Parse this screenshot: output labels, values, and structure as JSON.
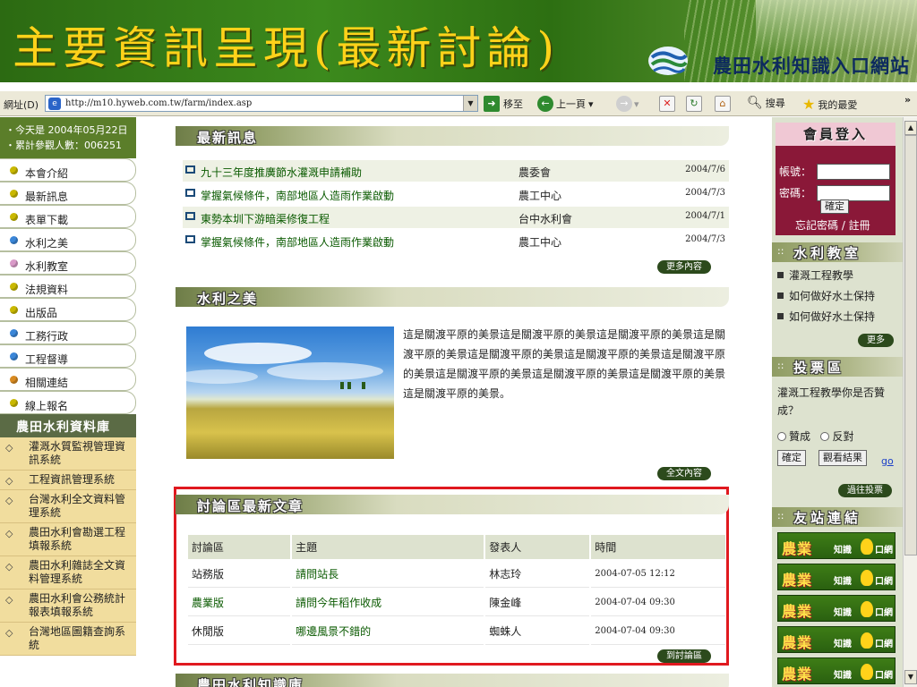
{
  "slide": {
    "title": "主要資訊呈現(最新討論)",
    "logo_text": "農田水利知識入口網站"
  },
  "browser": {
    "address_label": "網址(D)",
    "url": "http://m10.hyweb.com.tw/farm/index.asp",
    "go_label": "移至",
    "back_label": "上一頁",
    "search_label": "搜尋",
    "favorites_label": "我的最愛",
    "more_label": "»"
  },
  "left": {
    "date_line": "・今天是 2004年05月22日",
    "visitors_line": "・累計參觀人數：006251",
    "nav": [
      {
        "label": "本會介紹",
        "dot": "#c9b800"
      },
      {
        "label": "最新訊息",
        "dot": "#c9b800"
      },
      {
        "label": "表單下載",
        "dot": "#c9b800"
      },
      {
        "label": "水利之美",
        "dot": "#3a86d8"
      },
      {
        "label": "水利教室",
        "dot": "#d99ac8"
      },
      {
        "label": "法規資料",
        "dot": "#c9b800"
      },
      {
        "label": "出版品",
        "dot": "#c9b800"
      },
      {
        "label": "工務行政",
        "dot": "#3a86d8"
      },
      {
        "label": "工程督導",
        "dot": "#3a86d8"
      },
      {
        "label": "相關連結",
        "dot": "#d88a20"
      },
      {
        "label": "線上報名",
        "dot": "#c9b800"
      }
    ],
    "database_title": "農田水利資料庫",
    "database_items": [
      "灌溉水質監視管理資訊系統",
      "工程資訊管理系統",
      "台灣水利全文資料管理系統",
      "農田水利會勘選工程填報系統",
      "農田水利雜誌全文資料管理系統",
      "農田水利會公務統計報表填報系統",
      "台灣地區圖籍查詢系統"
    ]
  },
  "news": {
    "title": "最新訊息",
    "items": [
      {
        "title": "九十三年度推廣節水灌溉申請補助",
        "unit": "農委會",
        "date": "2004/7/6"
      },
      {
        "title": "掌握氣候條件，南部地區人造雨作業啟動",
        "unit": "農工中心",
        "date": "2004/7/3"
      },
      {
        "title": "東勢本圳下游暗渠修復工程",
        "unit": "台中水利會",
        "date": "2004/7/1"
      },
      {
        "title": "掌握氣候條件，南部地區人造雨作業啟動",
        "unit": "農工中心",
        "date": "2004/7/3"
      }
    ],
    "more_label": "更多內容"
  },
  "beauty": {
    "title": "水利之美",
    "text": "這是關渡平原的美景這是關渡平原的美景這是關渡平原的美景這是關渡平原的美景這是關渡平原的美景這是關渡平原的美景這是關渡平原的美景這是關渡平原的美景這是關渡平原的美景這是關渡平原的美景這是關渡平原的美景。",
    "more_label": "全文內容"
  },
  "discussion": {
    "title": "討論區最新文章",
    "headers": [
      "討論區",
      "主題",
      "發表人",
      "時間"
    ],
    "rows": [
      {
        "board": "站務版",
        "topic": "請問站長",
        "author": "林志玲",
        "time": "2004-07-05 12:12"
      },
      {
        "board": "農業版",
        "topic": "請問今年稻作收成",
        "author": "陳金峰",
        "time": "2004-07-04 09:30"
      },
      {
        "board": "休閒版",
        "topic": "哪邊風景不錯的",
        "author": "蜘蛛人",
        "time": "2004-07-04 09:30"
      }
    ],
    "more_label": "到討論區"
  },
  "next_section": "農田水利知識庫",
  "right": {
    "login_title": "會員登入",
    "account_label": "帳號：",
    "password_label": "密碼：",
    "confirm_label": "確定",
    "forgot_label": "忘記密碼 / 註冊",
    "classroom_title": "水利教室",
    "classroom_items": [
      "灌溉工程教學",
      "如何做好水土保持",
      "如何做好水土保持"
    ],
    "classroom_more": "更多",
    "poll_title": "投票區",
    "poll_question": "灌溉工程教學你是否贊成？",
    "poll_options": [
      "贊成",
      "反對"
    ],
    "poll_confirm": "確定",
    "poll_results": "觀看結果",
    "poll_go": "go",
    "poll_past": "過往投票",
    "links_title": "友站連結",
    "banner_a": "農業",
    "banner_b": "知識",
    "banner_c": "口網",
    "banner_count": 5
  }
}
